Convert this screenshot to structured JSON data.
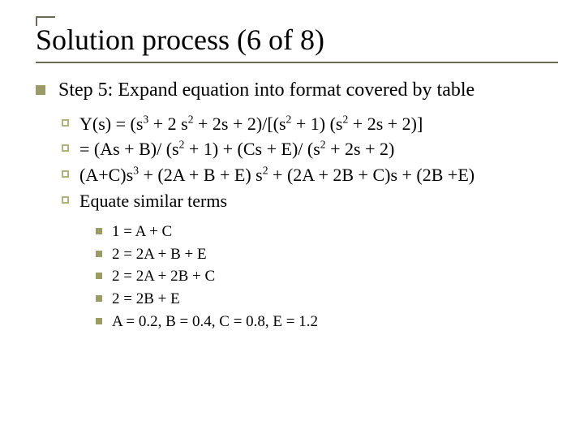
{
  "title": "Solution process (6 of 8)",
  "step_heading": "Step 5: Expand equation into format covered by table",
  "eqs": {
    "e1": {
      "a": "Y(s) = (s",
      "b": " + 2 s",
      "c": " + 2s + 2)/[(s",
      "d": " + 1) (s",
      "e": " + 2s + 2)]"
    },
    "e2": {
      "a": "= (As + B)/ (s",
      "b": " + 1) + (Cs + E)/ (s",
      "c": " + 2s + 2)"
    },
    "e3": {
      "a": "(A+C)s",
      "b": " + (2A + B + E) s",
      "c": " + (2A + 2B + C)s + (2B +E)"
    },
    "e4": "Equate similar terms"
  },
  "sup": {
    "three": "3",
    "two": "2"
  },
  "terms": {
    "t1": "1 = A + C",
    "t2": "2 = 2A + B + E",
    "t3": "2 = 2A + 2B + C",
    "t4": "2 = 2B + E",
    "t5": "A = 0.2, B = 0.4, C = 0.8, E = 1.2"
  }
}
